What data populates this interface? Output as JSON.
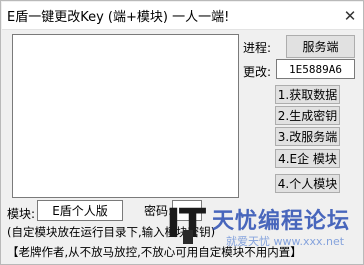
{
  "window": {
    "title": "E盾一键更改Key (端+模块) 一人一端!",
    "close_glyph": "✕"
  },
  "labels": {
    "process": "进程:",
    "change": "更改:",
    "module": "模块:",
    "password": "密码:"
  },
  "fields": {
    "process_value": "服务端",
    "change_value": "1E5889A6",
    "module_value": "E盾个人版",
    "password_value": ""
  },
  "buttons": {
    "get_data": "1.获取数据",
    "gen_key": "2.生成密钥",
    "change_server": "3.改服务端",
    "e_module": "4.E企 模块",
    "personal_module": "4.个人模块"
  },
  "notes": {
    "line1": "(自定模块放在运行目录下,输入模块密钥)",
    "line2": "【老牌作者,从不放马放控,不放心可用自定模块不用内置】"
  },
  "watermark": {
    "logo": "IT",
    "main": "天忧编程论坛",
    "sub": "就爱天忧 www.xxx.net"
  }
}
